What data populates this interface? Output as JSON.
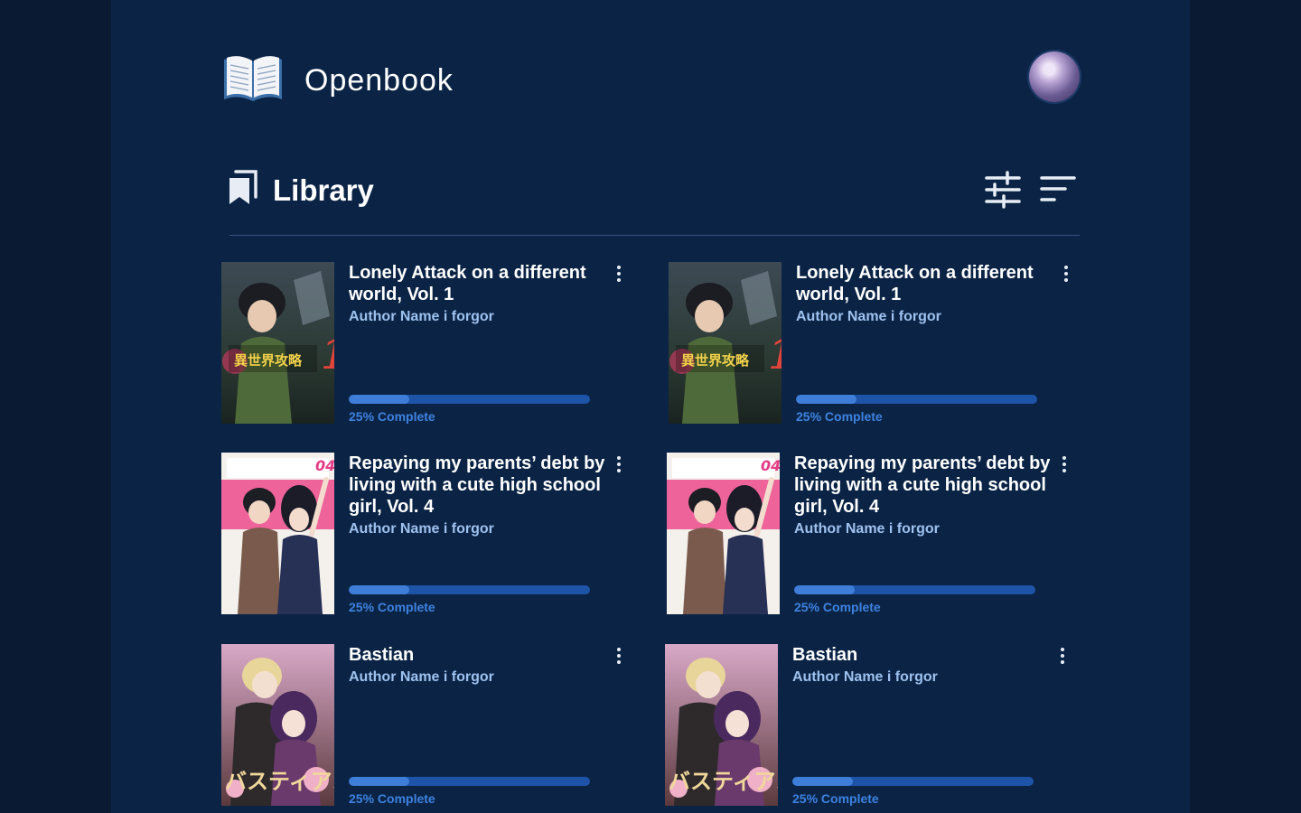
{
  "app": {
    "name": "Openbook"
  },
  "library": {
    "title": "Library"
  },
  "colors": {
    "panel": "#0b2446",
    "accent": "#3e7ed8",
    "track": "#1e54a7",
    "author": "#9ec1ee"
  },
  "books": [
    {
      "title": "Lonely Attack on a different world, Vol. 1",
      "author": "Author Name i forgor",
      "progress_text": "25% Complete",
      "progress": 0.25,
      "cover_style": "fantasy"
    },
    {
      "title": "Lonely Attack on a different world, Vol. 1",
      "author": "Author Name i forgor",
      "progress_text": "25% Complete",
      "progress": 0.25,
      "cover_style": "fantasy"
    },
    {
      "title": "Repaying my parents’ debt by living with a cute high school girl, Vol. 4",
      "author": "Author Name i forgor",
      "progress_text": "25% Complete",
      "progress": 0.25,
      "cover_style": "romcom"
    },
    {
      "title": "Repaying my parents’ debt by living with a cute high school girl, Vol. 4",
      "author": "Author Name i forgor",
      "progress_text": "25% Complete",
      "progress": 0.25,
      "cover_style": "romcom"
    },
    {
      "title": "Bastian",
      "author": "Author Name i forgor",
      "progress_text": "25% Complete",
      "progress": 0.25,
      "cover_style": "romance"
    },
    {
      "title": "Bastian",
      "author": "Author Name i forgor",
      "progress_text": "25% Complete",
      "progress": 0.25,
      "cover_style": "romance"
    }
  ]
}
